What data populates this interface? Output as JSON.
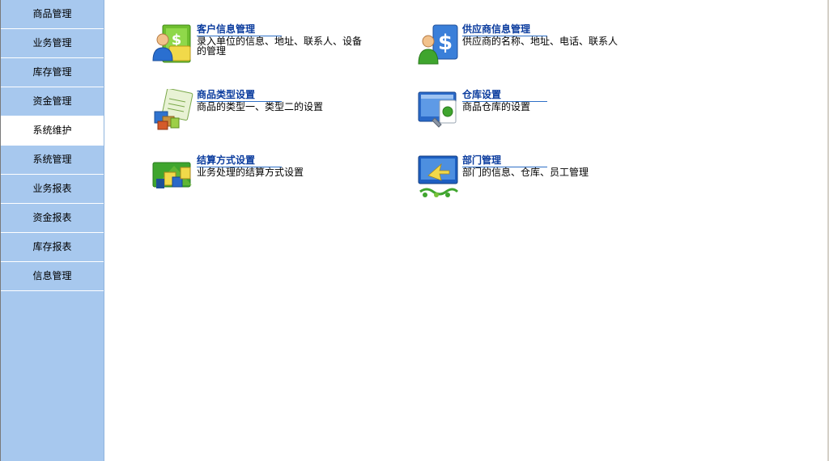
{
  "sidebar": {
    "items": [
      {
        "label": "商品管理"
      },
      {
        "label": "业务管理"
      },
      {
        "label": "库存管理"
      },
      {
        "label": "资金管理"
      },
      {
        "label": "系统维护"
      },
      {
        "label": "系统管理"
      },
      {
        "label": "业务报表"
      },
      {
        "label": "资金报表"
      },
      {
        "label": "库存报表"
      },
      {
        "label": "信息管理"
      }
    ],
    "active": "系统维护"
  },
  "tiles": [
    {
      "title": "客户信息管理",
      "desc": "录入单位的信息、地址、联系人、设备的管理",
      "icon": "customer-info-icon"
    },
    {
      "title": "供应商信息管理",
      "desc": "供应商的名称、地址、电话、联系人",
      "icon": "supplier-info-icon"
    },
    {
      "title": "商品类型设置",
      "desc": "商品的类型一、类型二的设置",
      "icon": "product-type-icon"
    },
    {
      "title": "仓库设置",
      "desc": "商品仓库的设置",
      "icon": "warehouse-icon"
    },
    {
      "title": "结算方式设置",
      "desc": "业务处理的结算方式设置",
      "icon": "settlement-icon"
    },
    {
      "title": "部门管理",
      "desc": "部门的信息、仓库、员工管理",
      "icon": "department-icon"
    }
  ],
  "colors": {
    "sidebar_bg": "#a7c8ee",
    "title_color": "#0b3c9e",
    "title_underline": "#2e6fc7"
  }
}
